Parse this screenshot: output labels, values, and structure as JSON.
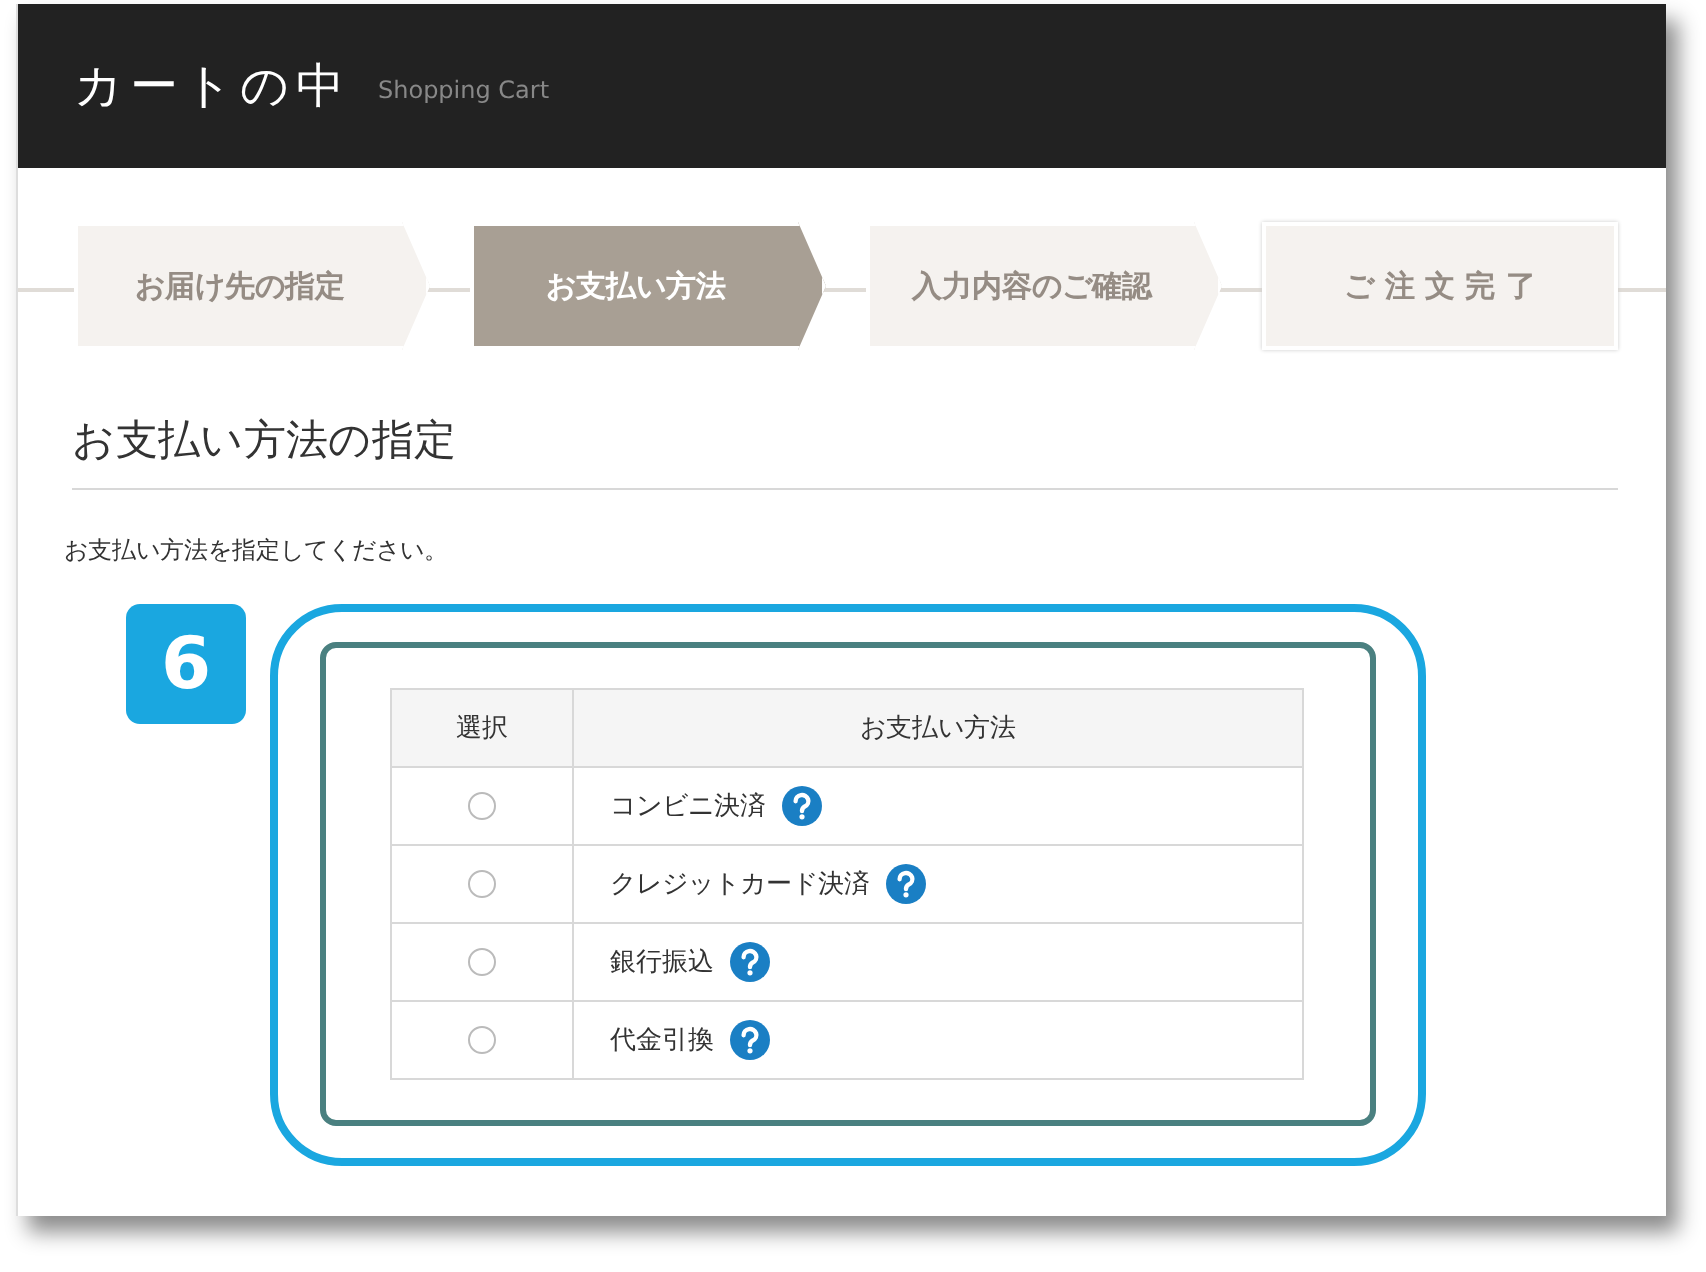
{
  "header": {
    "title": "カートの中",
    "subtitle": "Shopping Cart"
  },
  "steps": [
    {
      "label": "お届け先の指定",
      "selected": false
    },
    {
      "label": "お支払い方法",
      "selected": true
    },
    {
      "label": "入力内容のご確認",
      "selected": false
    },
    {
      "label": "ご 注 文 完 了",
      "selected": false
    }
  ],
  "section": {
    "heading": "お支払い方法の指定",
    "note": "お支払い方法を指定してください。"
  },
  "callout": {
    "badge": "6"
  },
  "table": {
    "columns": [
      "選択",
      "お支払い方法"
    ],
    "rows": [
      {
        "method": "コンビニ決済",
        "selected": false
      },
      {
        "method": "クレジットカード決済",
        "selected": false
      },
      {
        "method": "銀行振込",
        "selected": false
      },
      {
        "method": "代金引換",
        "selected": false
      }
    ]
  }
}
